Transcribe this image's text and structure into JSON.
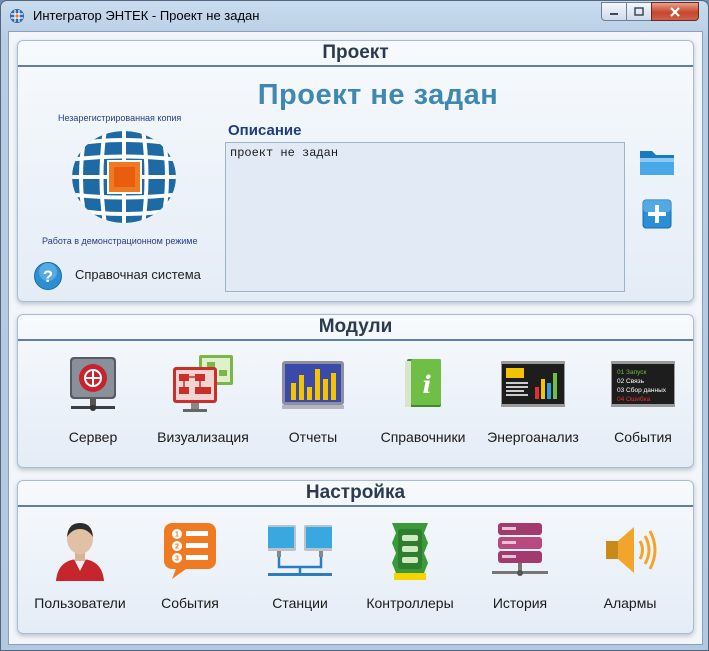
{
  "window": {
    "title": "Интегратор ЭНТЕК - Проект не задан"
  },
  "project": {
    "heading": "Проект",
    "name": "Проект не задан",
    "unregistered": "Незарегистрированная копия",
    "demo_mode": "Работа в демонстрационном режиме",
    "help_label": "Справочная система",
    "description_label": "Описание",
    "description_value": "проект не задан"
  },
  "modules": {
    "heading": "Модули",
    "items": [
      {
        "label": "Сервер",
        "icon": "server-icon"
      },
      {
        "label": "Визуализация",
        "icon": "visualization-icon"
      },
      {
        "label": "Отчеты",
        "icon": "reports-chart-icon"
      },
      {
        "label": "Справочники",
        "icon": "reference-book-icon"
      },
      {
        "label": "Энергоанализ",
        "icon": "energy-analysis-icon"
      },
      {
        "label": "События",
        "icon": "events-terminal-icon"
      }
    ],
    "events_screen_lines": [
      "01 Запуск",
      "02 Связь",
      "03 Сбор данных",
      "04 Ошибка"
    ]
  },
  "settings": {
    "heading": "Настройка",
    "items": [
      {
        "label": "Пользователи",
        "icon": "user-icon"
      },
      {
        "label": "События",
        "icon": "events-list-icon"
      },
      {
        "label": "Станции",
        "icon": "stations-icon"
      },
      {
        "label": "Контроллеры",
        "icon": "controller-icon"
      },
      {
        "label": "История",
        "icon": "history-database-icon"
      },
      {
        "label": "Алармы",
        "icon": "alarm-speaker-icon"
      }
    ]
  }
}
